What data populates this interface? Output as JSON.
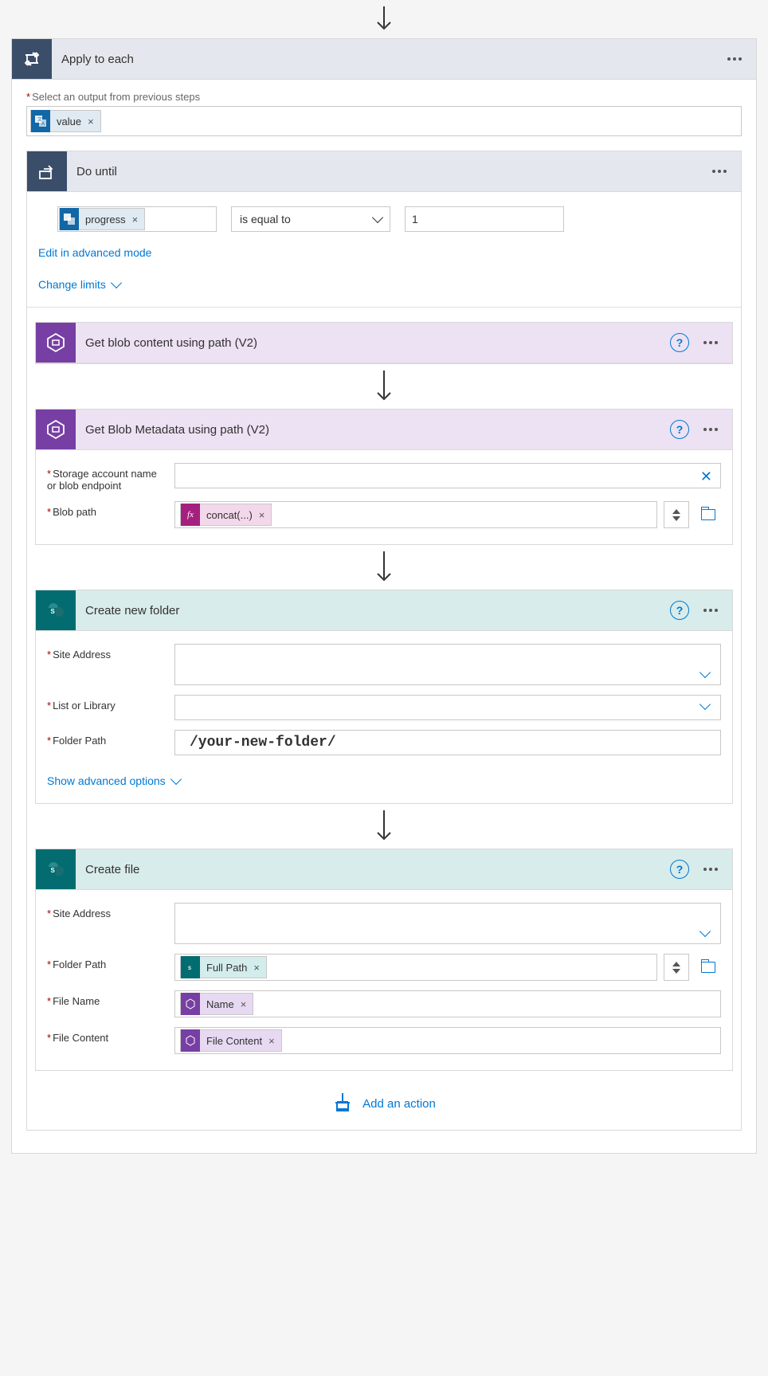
{
  "applyToEach": {
    "title": "Apply to each",
    "outputLabel": "Select an output from previous steps",
    "outputToken": "value"
  },
  "doUntil": {
    "title": "Do until",
    "leftToken": "progress",
    "operator": "is equal to",
    "rightValue": "1",
    "editLink": "Edit in advanced mode",
    "limitsLink": "Change limits"
  },
  "getBlobContent": {
    "title": "Get blob content using path (V2)"
  },
  "getBlobMeta": {
    "title": "Get Blob Metadata using path (V2)",
    "p1Label": "Storage account name or blob endpoint",
    "p2Label": "Blob path",
    "p2Token": "concat(...)"
  },
  "createFolder": {
    "title": "Create new folder",
    "p1Label": "Site Address",
    "p2Label": "List or Library",
    "p3Label": "Folder Path",
    "p3Value": "/your-new-folder/",
    "advLink": "Show advanced options"
  },
  "createFile": {
    "title": "Create file",
    "p1Label": "Site Address",
    "p2Label": "Folder Path",
    "p2Token": "Full Path",
    "p3Label": "File Name",
    "p3Token": "Name",
    "p4Label": "File Content",
    "p4Token": "File Content"
  },
  "addAction": "Add an action"
}
